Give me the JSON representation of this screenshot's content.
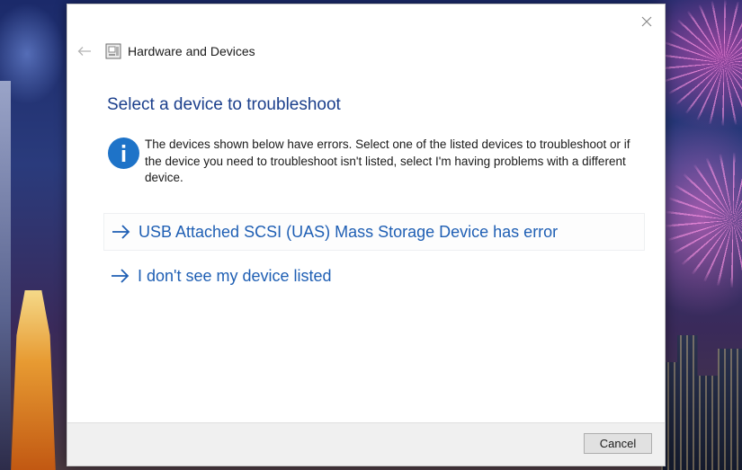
{
  "window": {
    "header_title": "Hardware and Devices",
    "close_icon": "close-icon",
    "back_icon": "back-arrow-icon"
  },
  "main": {
    "heading": "Select a device to troubleshoot",
    "info_icon": "info-icon",
    "info_text": "The devices shown below have errors. Select one of the listed devices to troubleshoot or if the device you need to troubleshoot isn't listed, select I'm having problems with a different device.",
    "options": [
      {
        "label": "USB Attached SCSI (UAS) Mass Storage Device has error",
        "icon": "arrow-right-icon"
      },
      {
        "label": "I don't see my device listed",
        "icon": "arrow-right-icon"
      }
    ]
  },
  "footer": {
    "cancel_label": "Cancel"
  },
  "colors": {
    "heading": "#1b3f8c",
    "link": "#1f5fb4",
    "info_icon": "#1e73c8",
    "footer_bg": "#f0f0f0"
  }
}
